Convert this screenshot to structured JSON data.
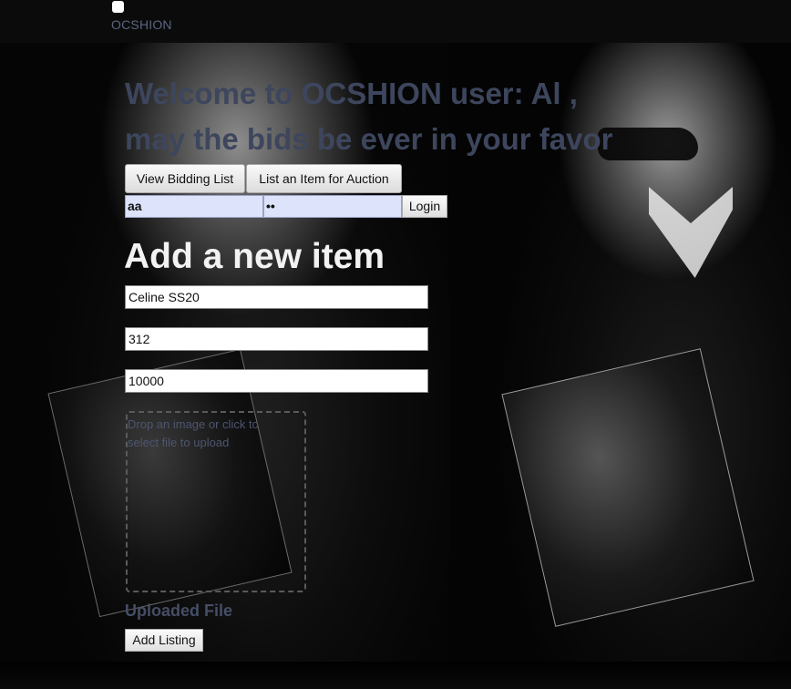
{
  "nav": {
    "brand": "OCSHION"
  },
  "welcome": {
    "line1": "Welcome to OCSHION user: Al ,",
    "line2": "may the bids be ever in your favor"
  },
  "actions": {
    "view_bidding_list": "View Bidding List",
    "list_item": "List an Item for Auction"
  },
  "login": {
    "username_value": "aa",
    "password_value": "••",
    "button_label": "Login"
  },
  "form": {
    "title": "Add a new item",
    "item_name": "Celine SS20",
    "field2": "312",
    "field3": "10000",
    "dropzone_text": "Drop an image or click to select file to upload",
    "uploaded_label": "Uploaded File",
    "submit_label": "Add Listing"
  }
}
